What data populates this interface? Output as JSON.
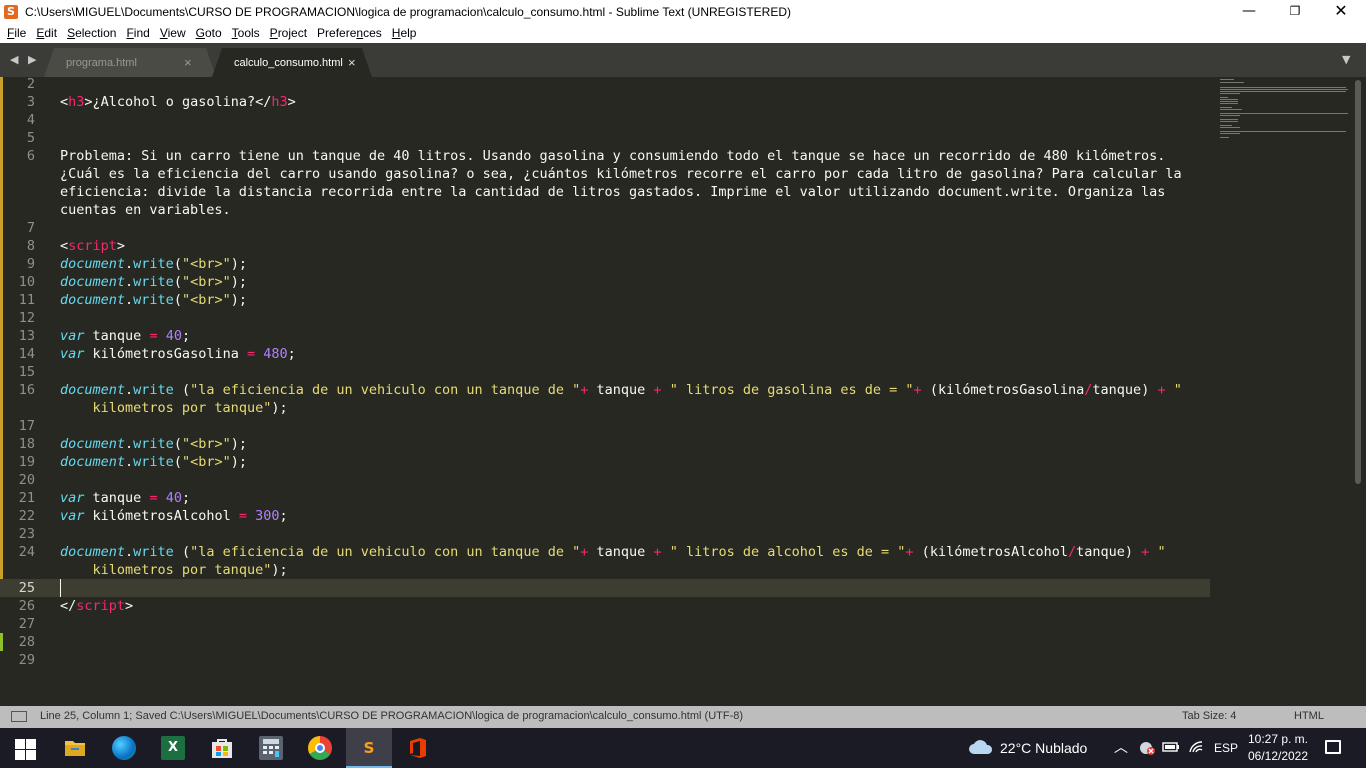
{
  "window": {
    "title": "C:\\Users\\MIGUEL\\Documents\\CURSO DE PROGRAMACION\\logica de programacion\\calculo_consumo.html - Sublime Text (UNREGISTERED)",
    "app_icon": "S",
    "minimize": "—",
    "maximize": "❐",
    "close": "✕"
  },
  "menu": [
    {
      "u": "F",
      "rest": "ile"
    },
    {
      "u": "E",
      "rest": "dit"
    },
    {
      "u": "S",
      "rest": "election"
    },
    {
      "u": "F",
      "rest": "ind",
      "pre": ""
    },
    {
      "u": "V",
      "rest": "iew"
    },
    {
      "u": "G",
      "rest": "oto"
    },
    {
      "u": "T",
      "rest": "ools"
    },
    {
      "u": "P",
      "rest": "roject"
    },
    {
      "u": "n",
      "pre": "Prefere",
      "rest": "ces"
    },
    {
      "u": "H",
      "rest": "elp"
    }
  ],
  "tabs": {
    "nav": "◀ ▶",
    "items": [
      {
        "label": "programa.html",
        "close": "×",
        "active": false
      },
      {
        "label": "calculo_consumo.html",
        "close": "×",
        "active": true
      }
    ],
    "dropdown": "▼"
  },
  "editor": {
    "line_numbers": [
      "2",
      "3",
      "4",
      "5",
      "6",
      "7",
      "8",
      "9",
      "10",
      "11",
      "12",
      "13",
      "14",
      "15",
      "16",
      "17",
      "18",
      "19",
      "20",
      "21",
      "22",
      "23",
      "24",
      "25",
      "26",
      "27",
      "28",
      "29"
    ],
    "current_line": "25",
    "code": {
      "h3_open": "h3",
      "h3_text": "¿Alcohol o gasolina?",
      "h3_close": "h3",
      "problem_1": "Problema: Si un carro tiene un tanque de 40 litros. Usando gasolina y consumiendo todo el tanque se hace un recorrido de 480 kilómetros.",
      "problem_2": "¿Cuál es la eficiencia del carro usando gasolina? o sea, ¿cuántos kilómetros recorre el carro por cada litro de gasolina? Para calcular la",
      "problem_3": "eficiencia: divide la distancia recorrida entre la cantidad de litros gastados. Imprime el valor utilizando document.write. Organiza las",
      "problem_4": "cuentas en variables.",
      "script_tag": "script",
      "document": "document",
      "write": "write",
      "br_string": "\"<br>\"",
      "var_kw": "var",
      "tanque": "tanque",
      "val_40": "40",
      "km_gasolina": "kilómetrosGasolina",
      "val_480": "480",
      "km_alcohol": "kilómetrosAlcohol",
      "val_300": "300",
      "str_eff": "\"la eficiencia de un vehiculo con un tanque de \"",
      "str_gas": "\" litros de gasolina es de = \"",
      "str_alc": "\" litros de alcohol es de = \"",
      "str_km_open": "\"",
      "str_km_close": "kilometros por tanque\""
    }
  },
  "status": {
    "text": "Line 25, Column 1; Saved C:\\Users\\MIGUEL\\Documents\\CURSO DE PROGRAMACION\\logica de programacion\\calculo_consumo.html (UTF-8)",
    "tab_size": "Tab Size: 4",
    "syntax": "HTML"
  },
  "taskbar": {
    "excel_letter": "X",
    "sublime_letter": "S",
    "weather": "22°C  Nublado",
    "chevron": "︿",
    "language": "ESP",
    "time": "10:27 p. m.",
    "date": "06/12/2022"
  },
  "colors": {
    "editor_bg": "#272822",
    "tag": "#f92672",
    "string": "#e6db74",
    "number": "#ae81ff",
    "support": "#66d9ef"
  }
}
